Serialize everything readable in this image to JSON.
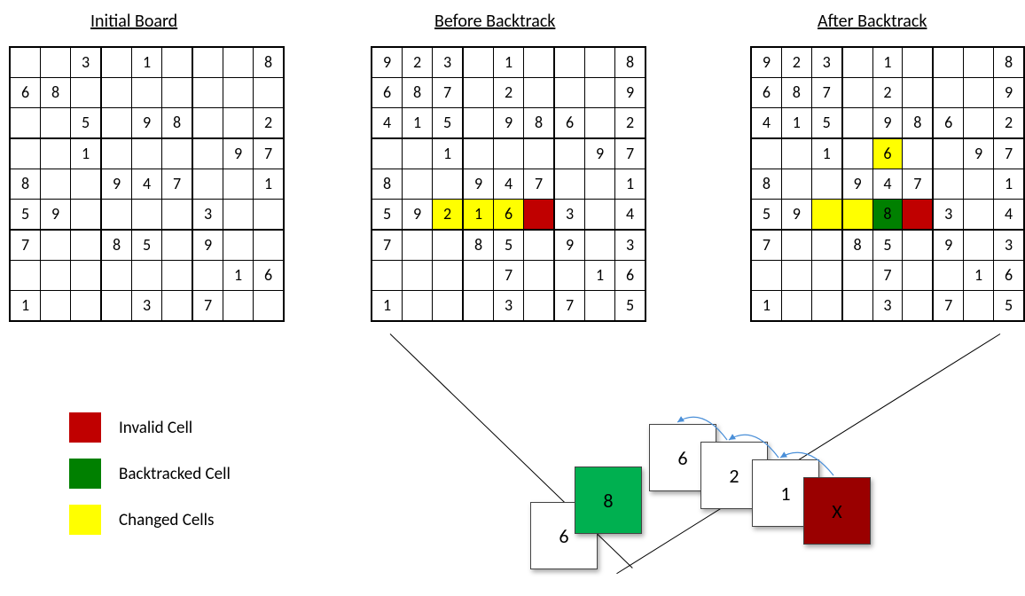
{
  "titles": {
    "initial": "Initial Board",
    "before": "Before Backtrack",
    "after": "After Backtrack"
  },
  "legend": {
    "invalid": "Invalid Cell",
    "backtracked": "Backtracked Cell",
    "changed": "Changed Cells"
  },
  "colors": {
    "invalid": "#C00000",
    "backtracked": "#008000",
    "changed": "#FFFF00",
    "tile_green": "#00B050",
    "tile_red": "#9A0000"
  },
  "boards": {
    "initial": [
      [
        "",
        "",
        "3",
        "",
        "1",
        "",
        "",
        "",
        "8"
      ],
      [
        "6",
        "8",
        "",
        "",
        "",
        "",
        "",
        "",
        ""
      ],
      [
        "",
        "",
        "5",
        "",
        "9",
        "8",
        "",
        "",
        "2"
      ],
      [
        "",
        "",
        "1",
        "",
        "",
        "",
        "",
        "9",
        "7"
      ],
      [
        "8",
        "",
        "",
        "9",
        "4",
        "7",
        "",
        "",
        "1"
      ],
      [
        "5",
        "9",
        "",
        "",
        "",
        "",
        "3",
        "",
        ""
      ],
      [
        "7",
        "",
        "",
        "8",
        "5",
        "",
        "9",
        "",
        ""
      ],
      [
        "",
        "",
        "",
        "",
        "",
        "",
        "",
        "1",
        "6"
      ],
      [
        "1",
        "",
        "",
        "",
        "3",
        "",
        "7",
        "",
        ""
      ]
    ],
    "before": [
      [
        "9",
        "2",
        "3",
        "",
        "1",
        "",
        "",
        "",
        "8"
      ],
      [
        "6",
        "8",
        "7",
        "",
        "2",
        "",
        "",
        "",
        "9"
      ],
      [
        "4",
        "1",
        "5",
        "",
        "9",
        "8",
        "6",
        "",
        "2"
      ],
      [
        "",
        "",
        "1",
        "",
        "",
        "",
        "",
        "9",
        "7"
      ],
      [
        "8",
        "",
        "",
        "9",
        "4",
        "7",
        "",
        "",
        "1"
      ],
      [
        "5",
        "9",
        "2",
        "1",
        "6",
        "",
        "3",
        "",
        "4"
      ],
      [
        "7",
        "",
        "",
        "8",
        "5",
        "",
        "9",
        "",
        "3"
      ],
      [
        "",
        "",
        "",
        "",
        "7",
        "",
        "",
        "1",
        "6"
      ],
      [
        "1",
        "",
        "",
        "",
        "3",
        "",
        "7",
        "",
        "5"
      ]
    ],
    "after": [
      [
        "9",
        "2",
        "3",
        "",
        "1",
        "",
        "",
        "",
        "8"
      ],
      [
        "6",
        "8",
        "7",
        "",
        "2",
        "",
        "",
        "",
        "9"
      ],
      [
        "4",
        "1",
        "5",
        "",
        "9",
        "8",
        "6",
        "",
        "2"
      ],
      [
        "",
        "",
        "1",
        "",
        "6",
        "",
        "",
        "9",
        "7"
      ],
      [
        "8",
        "",
        "",
        "9",
        "4",
        "7",
        "",
        "",
        "1"
      ],
      [
        "5",
        "9",
        "",
        "",
        "8",
        "",
        "3",
        "",
        "4"
      ],
      [
        "7",
        "",
        "",
        "8",
        "5",
        "",
        "9",
        "",
        "3"
      ],
      [
        "",
        "",
        "",
        "",
        "7",
        "",
        "",
        "1",
        "6"
      ],
      [
        "1",
        "",
        "",
        "",
        "3",
        "",
        "7",
        "",
        "5"
      ]
    ]
  },
  "highlights": {
    "before": [
      {
        "r": 5,
        "c": 2,
        "type": "changed"
      },
      {
        "r": 5,
        "c": 3,
        "type": "changed"
      },
      {
        "r": 5,
        "c": 4,
        "type": "changed"
      },
      {
        "r": 5,
        "c": 5,
        "type": "invalid"
      }
    ],
    "after": [
      {
        "r": 3,
        "c": 4,
        "type": "changed"
      },
      {
        "r": 5,
        "c": 2,
        "type": "changed"
      },
      {
        "r": 5,
        "c": 3,
        "type": "changed"
      },
      {
        "r": 5,
        "c": 4,
        "type": "backtracked"
      },
      {
        "r": 5,
        "c": 5,
        "type": "invalid"
      }
    ]
  },
  "stack_tiles": [
    {
      "label": "6",
      "style": "plain"
    },
    {
      "label": "8",
      "style": "green"
    },
    {
      "label": "6",
      "style": "plain"
    },
    {
      "label": "2",
      "style": "plain"
    },
    {
      "label": "1",
      "style": "plain"
    },
    {
      "label": "X",
      "style": "darkred"
    }
  ]
}
